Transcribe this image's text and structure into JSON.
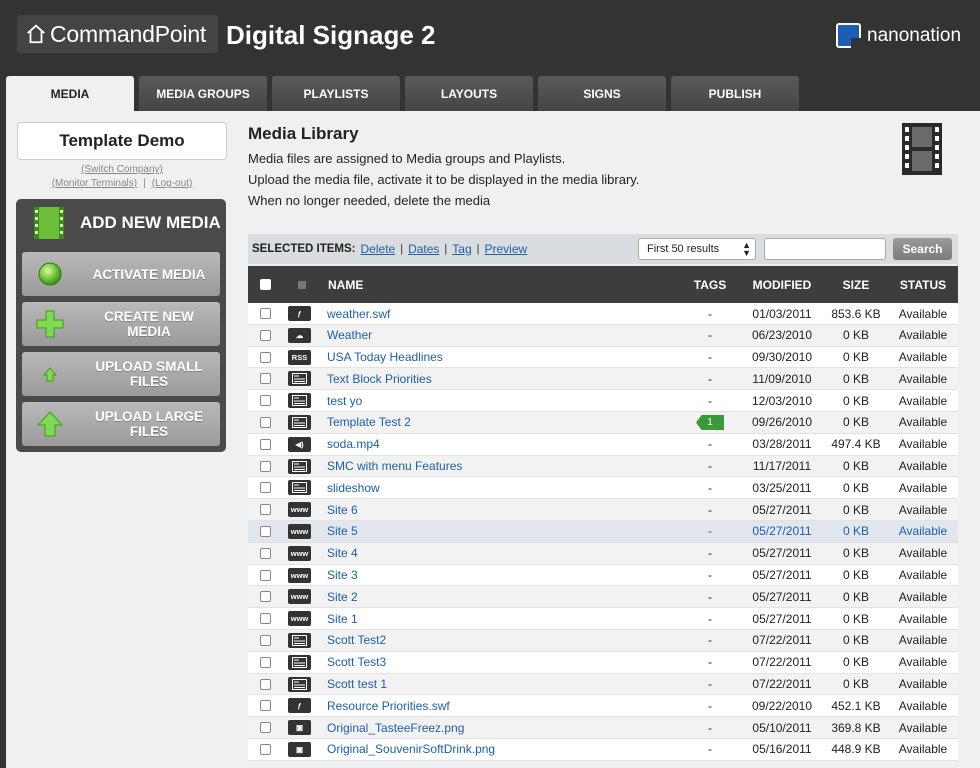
{
  "header": {
    "brand": "CommandPoint",
    "app_title": "Digital Signage 2",
    "partner": "nanonation"
  },
  "tabs": [
    {
      "label": "MEDIA",
      "active": true
    },
    {
      "label": "MEDIA GROUPS"
    },
    {
      "label": "PLAYLISTS"
    },
    {
      "label": "LAYOUTS"
    },
    {
      "label": "SIGNS"
    },
    {
      "label": "PUBLISH"
    }
  ],
  "sidebar": {
    "company": "Template Demo",
    "switch_company": "(Switch Company)",
    "monitor_terminals": "(Monitor Terminals)",
    "separator": "|",
    "logout": "(Log-out)",
    "add_new": "ADD NEW MEDIA",
    "buttons": [
      {
        "label": "ACTIVATE MEDIA",
        "icon": "green-orb-icon"
      },
      {
        "label": "CREATE NEW MEDIA",
        "icon": "plus-icon"
      },
      {
        "label": "UPLOAD SMALL FILES",
        "icon": "small-upload-arrow-icon"
      },
      {
        "label": "UPLOAD LARGE FILES",
        "icon": "large-upload-arrow-icon"
      }
    ]
  },
  "content": {
    "title": "Media Library",
    "desc_1": "Media files are assigned to Media groups and Playlists.",
    "desc_2": "Upload the media file, activate it to be displayed in the media library.",
    "desc_3": "When no longer needed, delete the media"
  },
  "selected": {
    "label": "SELECTED ITEMS:",
    "delete": "Delete",
    "dates": "Dates",
    "tag": "Tag",
    "preview": "Preview",
    "sep": "|",
    "results": "First 50 results",
    "search_btn": "Search"
  },
  "table": {
    "columns": {
      "name": "NAME",
      "tags": "TAGS",
      "modified": "MODIFIED",
      "size": "SIZE",
      "status": "STATUS"
    },
    "rows": [
      {
        "name": "weather.swf",
        "type": "flash",
        "tags": "-",
        "modified": "01/03/2011",
        "size": "853.6 KB",
        "status": "Available"
      },
      {
        "name": "Weather",
        "type": "weather",
        "tags": "-",
        "modified": "06/23/2010",
        "size": "0 KB",
        "status": "Available"
      },
      {
        "name": "USA Today Headlines",
        "type": "RSS",
        "tags": "-",
        "modified": "09/30/2010",
        "size": "0 KB",
        "status": "Available"
      },
      {
        "name": "Text Block Priorities",
        "type": "text",
        "tags": "-",
        "modified": "11/09/2010",
        "size": "0 KB",
        "status": "Available"
      },
      {
        "name": "test yo",
        "type": "text",
        "tags": "-",
        "modified": "12/03/2010",
        "size": "0 KB",
        "status": "Available"
      },
      {
        "name": "Template Test 2",
        "type": "text",
        "tags": "1",
        "modified": "09/26/2010",
        "size": "0 KB",
        "status": "Available"
      },
      {
        "name": "soda.mp4",
        "type": "audio",
        "tags": "-",
        "modified": "03/28/2011",
        "size": "497.4 KB",
        "status": "Available"
      },
      {
        "name": "SMC with menu Features",
        "type": "text",
        "tags": "-",
        "modified": "11/17/2011",
        "size": "0 KB",
        "status": "Available"
      },
      {
        "name": "slideshow",
        "type": "text",
        "tags": "-",
        "modified": "03/25/2011",
        "size": "0 KB",
        "status": "Available"
      },
      {
        "name": "Site 6",
        "type": "www",
        "tags": "-",
        "modified": "05/27/2011",
        "size": "0 KB",
        "status": "Available"
      },
      {
        "name": "Site 5",
        "type": "www",
        "tags": "-",
        "modified": "05/27/2011",
        "size": "0 KB",
        "status": "Available",
        "highlight": true
      },
      {
        "name": "Site 4",
        "type": "www",
        "tags": "-",
        "modified": "05/27/2011",
        "size": "0 KB",
        "status": "Available"
      },
      {
        "name": "Site 3",
        "type": "www",
        "tags": "-",
        "modified": "05/27/2011",
        "size": "0 KB",
        "status": "Available"
      },
      {
        "name": "Site 2",
        "type": "www",
        "tags": "-",
        "modified": "05/27/2011",
        "size": "0 KB",
        "status": "Available"
      },
      {
        "name": "Site 1",
        "type": "www",
        "tags": "-",
        "modified": "05/27/2011",
        "size": "0 KB",
        "status": "Available"
      },
      {
        "name": "Scott Test2",
        "type": "text",
        "tags": "-",
        "modified": "07/22/2011",
        "size": "0 KB",
        "status": "Available"
      },
      {
        "name": "Scott Test3",
        "type": "text",
        "tags": "-",
        "modified": "07/22/2011",
        "size": "0 KB",
        "status": "Available"
      },
      {
        "name": "Scott test 1",
        "type": "text",
        "tags": "-",
        "modified": "07/22/2011",
        "size": "0 KB",
        "status": "Available"
      },
      {
        "name": "Resource Priorities.swf",
        "type": "flash",
        "tags": "-",
        "modified": "09/22/2010",
        "size": "452.1 KB",
        "status": "Available"
      },
      {
        "name": "Original_TasteeFreez.png",
        "type": "image",
        "tags": "-",
        "modified": "05/10/2011",
        "size": "369.8 KB",
        "status": "Available"
      },
      {
        "name": "Original_SouvenirSoftDrink.png",
        "type": "image",
        "tags": "-",
        "modified": "05/16/2011",
        "size": "448.9 KB",
        "status": "Available"
      }
    ]
  }
}
